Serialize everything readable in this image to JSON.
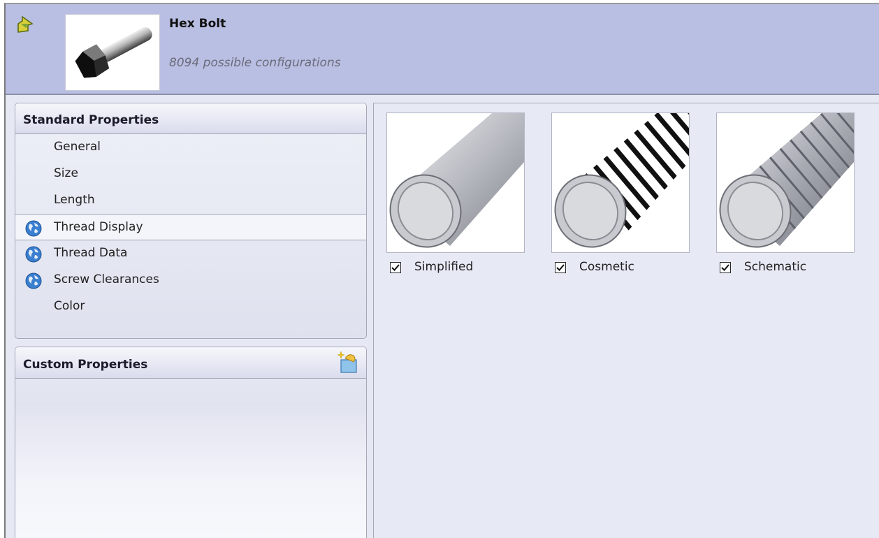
{
  "header": {
    "title": "Hex Bolt",
    "subtitle": "8094 possible configurations",
    "back_icon": "back-arrow-icon",
    "thumbnail": "hex-bolt-thumbnail"
  },
  "standard_properties": {
    "title": "Standard Properties",
    "items": [
      {
        "label": "General",
        "icon": null,
        "selected": false
      },
      {
        "label": "Size",
        "icon": null,
        "selected": false
      },
      {
        "label": "Length",
        "icon": null,
        "selected": false
      },
      {
        "label": "Thread Display",
        "icon": "globe-icon",
        "selected": true
      },
      {
        "label": "Thread Data",
        "icon": "globe-icon",
        "selected": false
      },
      {
        "label": "Screw Clearances",
        "icon": "globe-icon",
        "selected": false
      },
      {
        "label": "Color",
        "icon": null,
        "selected": false
      }
    ]
  },
  "custom_properties": {
    "title": "Custom Properties",
    "add_icon": "add-custom-property-icon"
  },
  "thread_options": [
    {
      "label": "Simplified",
      "checked": true,
      "style": "simplified"
    },
    {
      "label": "Cosmetic",
      "checked": true,
      "style": "cosmetic"
    },
    {
      "label": "Schematic",
      "checked": true,
      "style": "schematic"
    }
  ],
  "colors": {
    "header_bg": "#b9bfe3",
    "panel_bg": "#e6e8f4"
  }
}
